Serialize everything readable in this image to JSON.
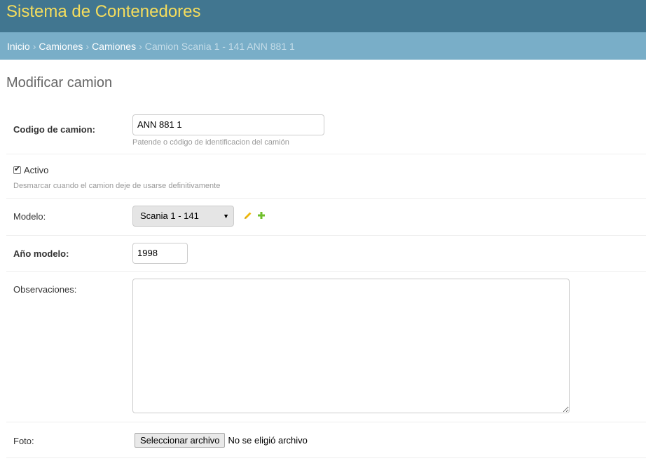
{
  "header": {
    "site_name": "Sistema de Contenedores"
  },
  "breadcrumbs": {
    "items": [
      "Inicio",
      "Camiones",
      "Camiones"
    ],
    "separator": "›",
    "current": "Camion Scania 1 - 141 ANN 881 1"
  },
  "page": {
    "title": "Modificar camion"
  },
  "form": {
    "codigo": {
      "label": "Codigo de camion:",
      "value": "ANN 881 1",
      "help": "Patende o código de identificacion del camión"
    },
    "activo": {
      "label": "Activo",
      "checked": true,
      "help": "Desmarcar cuando el camion deje de usarse definitivamente"
    },
    "modelo": {
      "label": "Modelo:",
      "selected": "Scania 1 - 141",
      "edit_icon": "pencil-icon",
      "add_icon": "plus-icon"
    },
    "anio": {
      "label": "Año modelo:",
      "value": "1998"
    },
    "observaciones": {
      "label": "Observaciones:",
      "value": ""
    },
    "foto": {
      "label": "Foto:",
      "button_label": "Seleccionar archivo",
      "status": "No se eligió archivo"
    }
  },
  "colors": {
    "header_bg": "#417690",
    "site_name": "#f5dd5d",
    "breadcrumbs_bg": "#79aec8",
    "edit_icon": "#efb80b",
    "add_icon": "#70bf2b"
  }
}
